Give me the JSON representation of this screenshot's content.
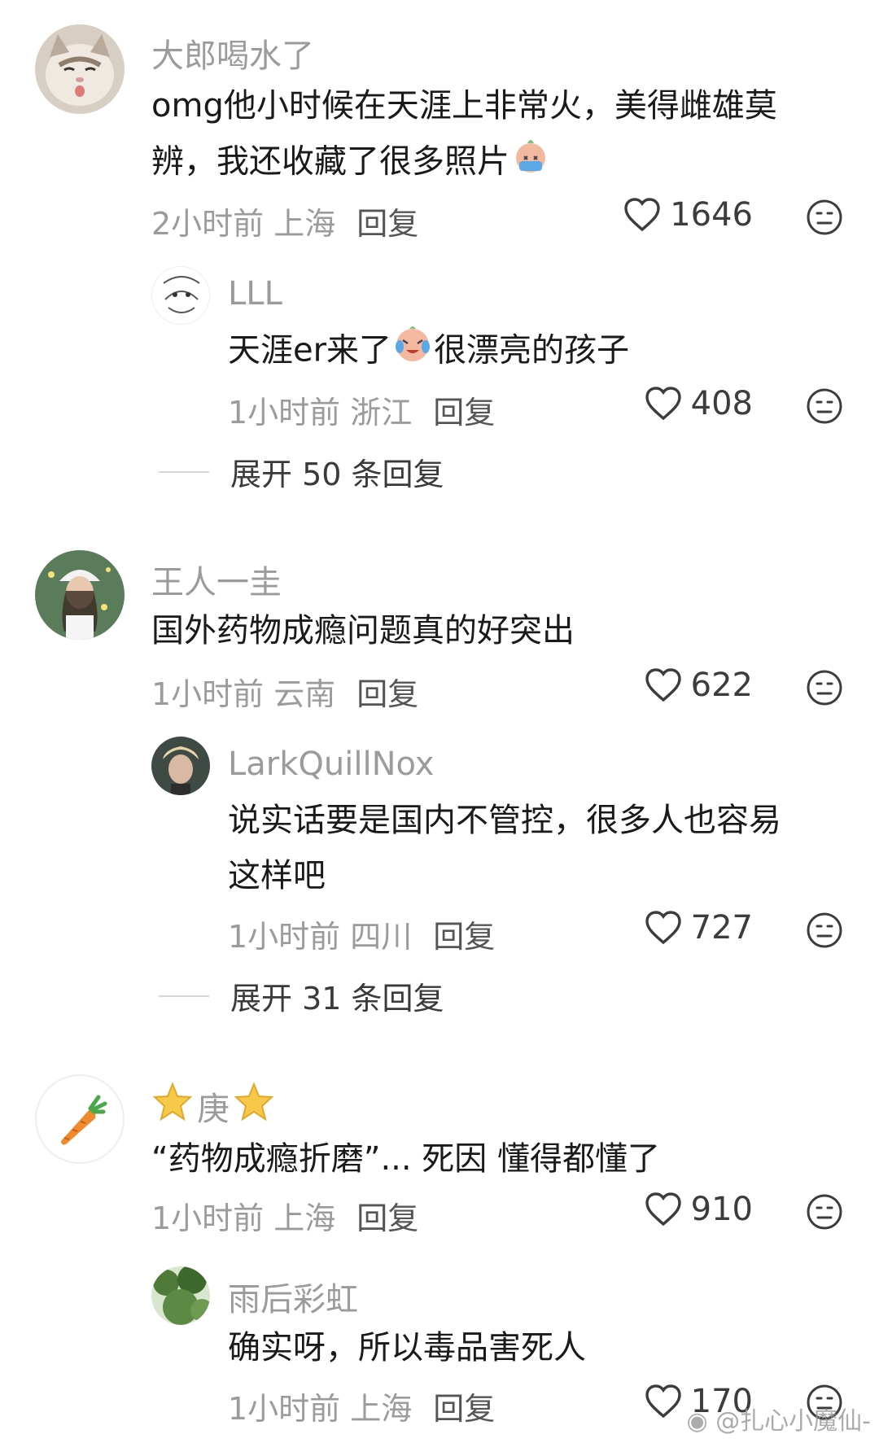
{
  "comments": [
    {
      "username": "大郎喝水了",
      "text_line1": "omg他小时候在天涯上非常火，美得雌雄莫",
      "text_line2": "辨，我还收藏了很多照片",
      "time_location": "2小时前 上海",
      "reply": "回复",
      "likes": "1646",
      "avatar_icon": "cat-avatar-icon",
      "reply_item": {
        "username": "LLL",
        "text_a": "天涯er来了",
        "text_b": "很漂亮的孩子",
        "time_location": "1小时前 浙江",
        "reply": "回复",
        "likes": "408"
      },
      "expand": "展开 50 条回复"
    },
    {
      "username": "王人一圭",
      "text": "国外药物成瘾问题真的好突出",
      "time_location": "1小时前 云南",
      "reply": "回复",
      "likes": "622",
      "reply_item": {
        "username": "LarkQuillNox",
        "text_line1": "说实话要是国内不管控，很多人也容易",
        "text_line2": "这样吧",
        "time_location": "1小时前 四川",
        "reply": "回复",
        "likes": "727"
      },
      "expand": "展开 31 条回复"
    },
    {
      "username": "庚",
      "text": "“药物成瘾折磨”... 死因 懂得都懂了",
      "time_location": "1小时前 上海",
      "reply": "回复",
      "likes": "910",
      "reply_item": {
        "username": "雨后彩虹",
        "text": "确实呀，所以毒品害死人",
        "time_location": "1小时前 上海",
        "reply": "回复",
        "likes": "170"
      }
    }
  ],
  "watermark": "@扎心小魔仙-",
  "colors": {
    "username": "#9b9b9b",
    "text": "#1a1a1a",
    "meta": "#9b9b9b"
  }
}
